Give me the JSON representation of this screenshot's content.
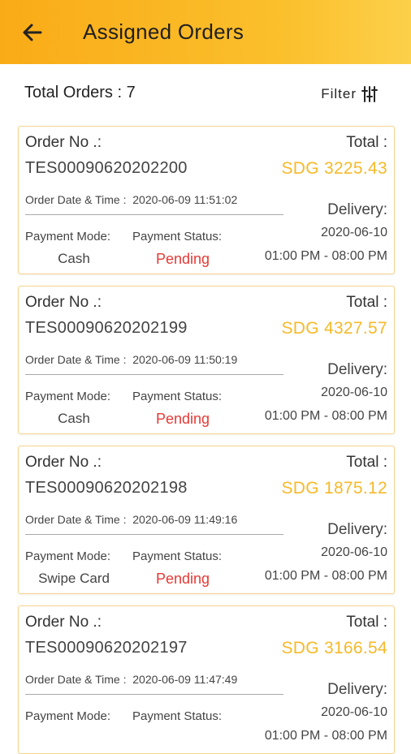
{
  "header": {
    "title": "Assigned Orders",
    "back_icon": "arrow-left-icon",
    "background": "#f9ab17"
  },
  "summary": {
    "total_orders": "Total Orders : 7",
    "filter_label": "Filter",
    "filter_icon": "sliders-icon"
  },
  "labels": {
    "order_no": "Order No .:",
    "total": "Total :",
    "delivery": "Delivery:",
    "payment_mode": "Payment Mode:",
    "payment_status": "Payment Status:",
    "order_date_prefix": "Order Date & Time :"
  },
  "colors": {
    "amount": "#f7b928",
    "pending": "#e53935",
    "card_border": "#f6d38c"
  },
  "orders": [
    {
      "order_no": "TES00090620202200",
      "amount": "SDG 3225.43",
      "order_datetime": "2020-06-09 11:51:02",
      "payment_mode": "Cash",
      "payment_status": "Pending",
      "delivery_date": "2020-06-10",
      "delivery_slot": "01:00 PM - 08:00 PM"
    },
    {
      "order_no": "TES00090620202199",
      "amount": "SDG 4327.57",
      "order_datetime": "2020-06-09 11:50:19",
      "payment_mode": "Cash",
      "payment_status": "Pending",
      "delivery_date": "2020-06-10",
      "delivery_slot": "01:00 PM - 08:00 PM"
    },
    {
      "order_no": "TES00090620202198",
      "amount": "SDG 1875.12",
      "order_datetime": "2020-06-09 11:49:16",
      "payment_mode": "Swipe Card",
      "payment_status": "Pending",
      "delivery_date": "2020-06-10",
      "delivery_slot": "01:00 PM - 08:00 PM"
    },
    {
      "order_no": "TES00090620202197",
      "amount": "SDG 3166.54",
      "order_datetime": "2020-06-09 11:47:49",
      "payment_mode": "",
      "payment_status": "",
      "delivery_date": "2020-06-10",
      "delivery_slot": "01:00 PM - 08:00 PM"
    }
  ]
}
